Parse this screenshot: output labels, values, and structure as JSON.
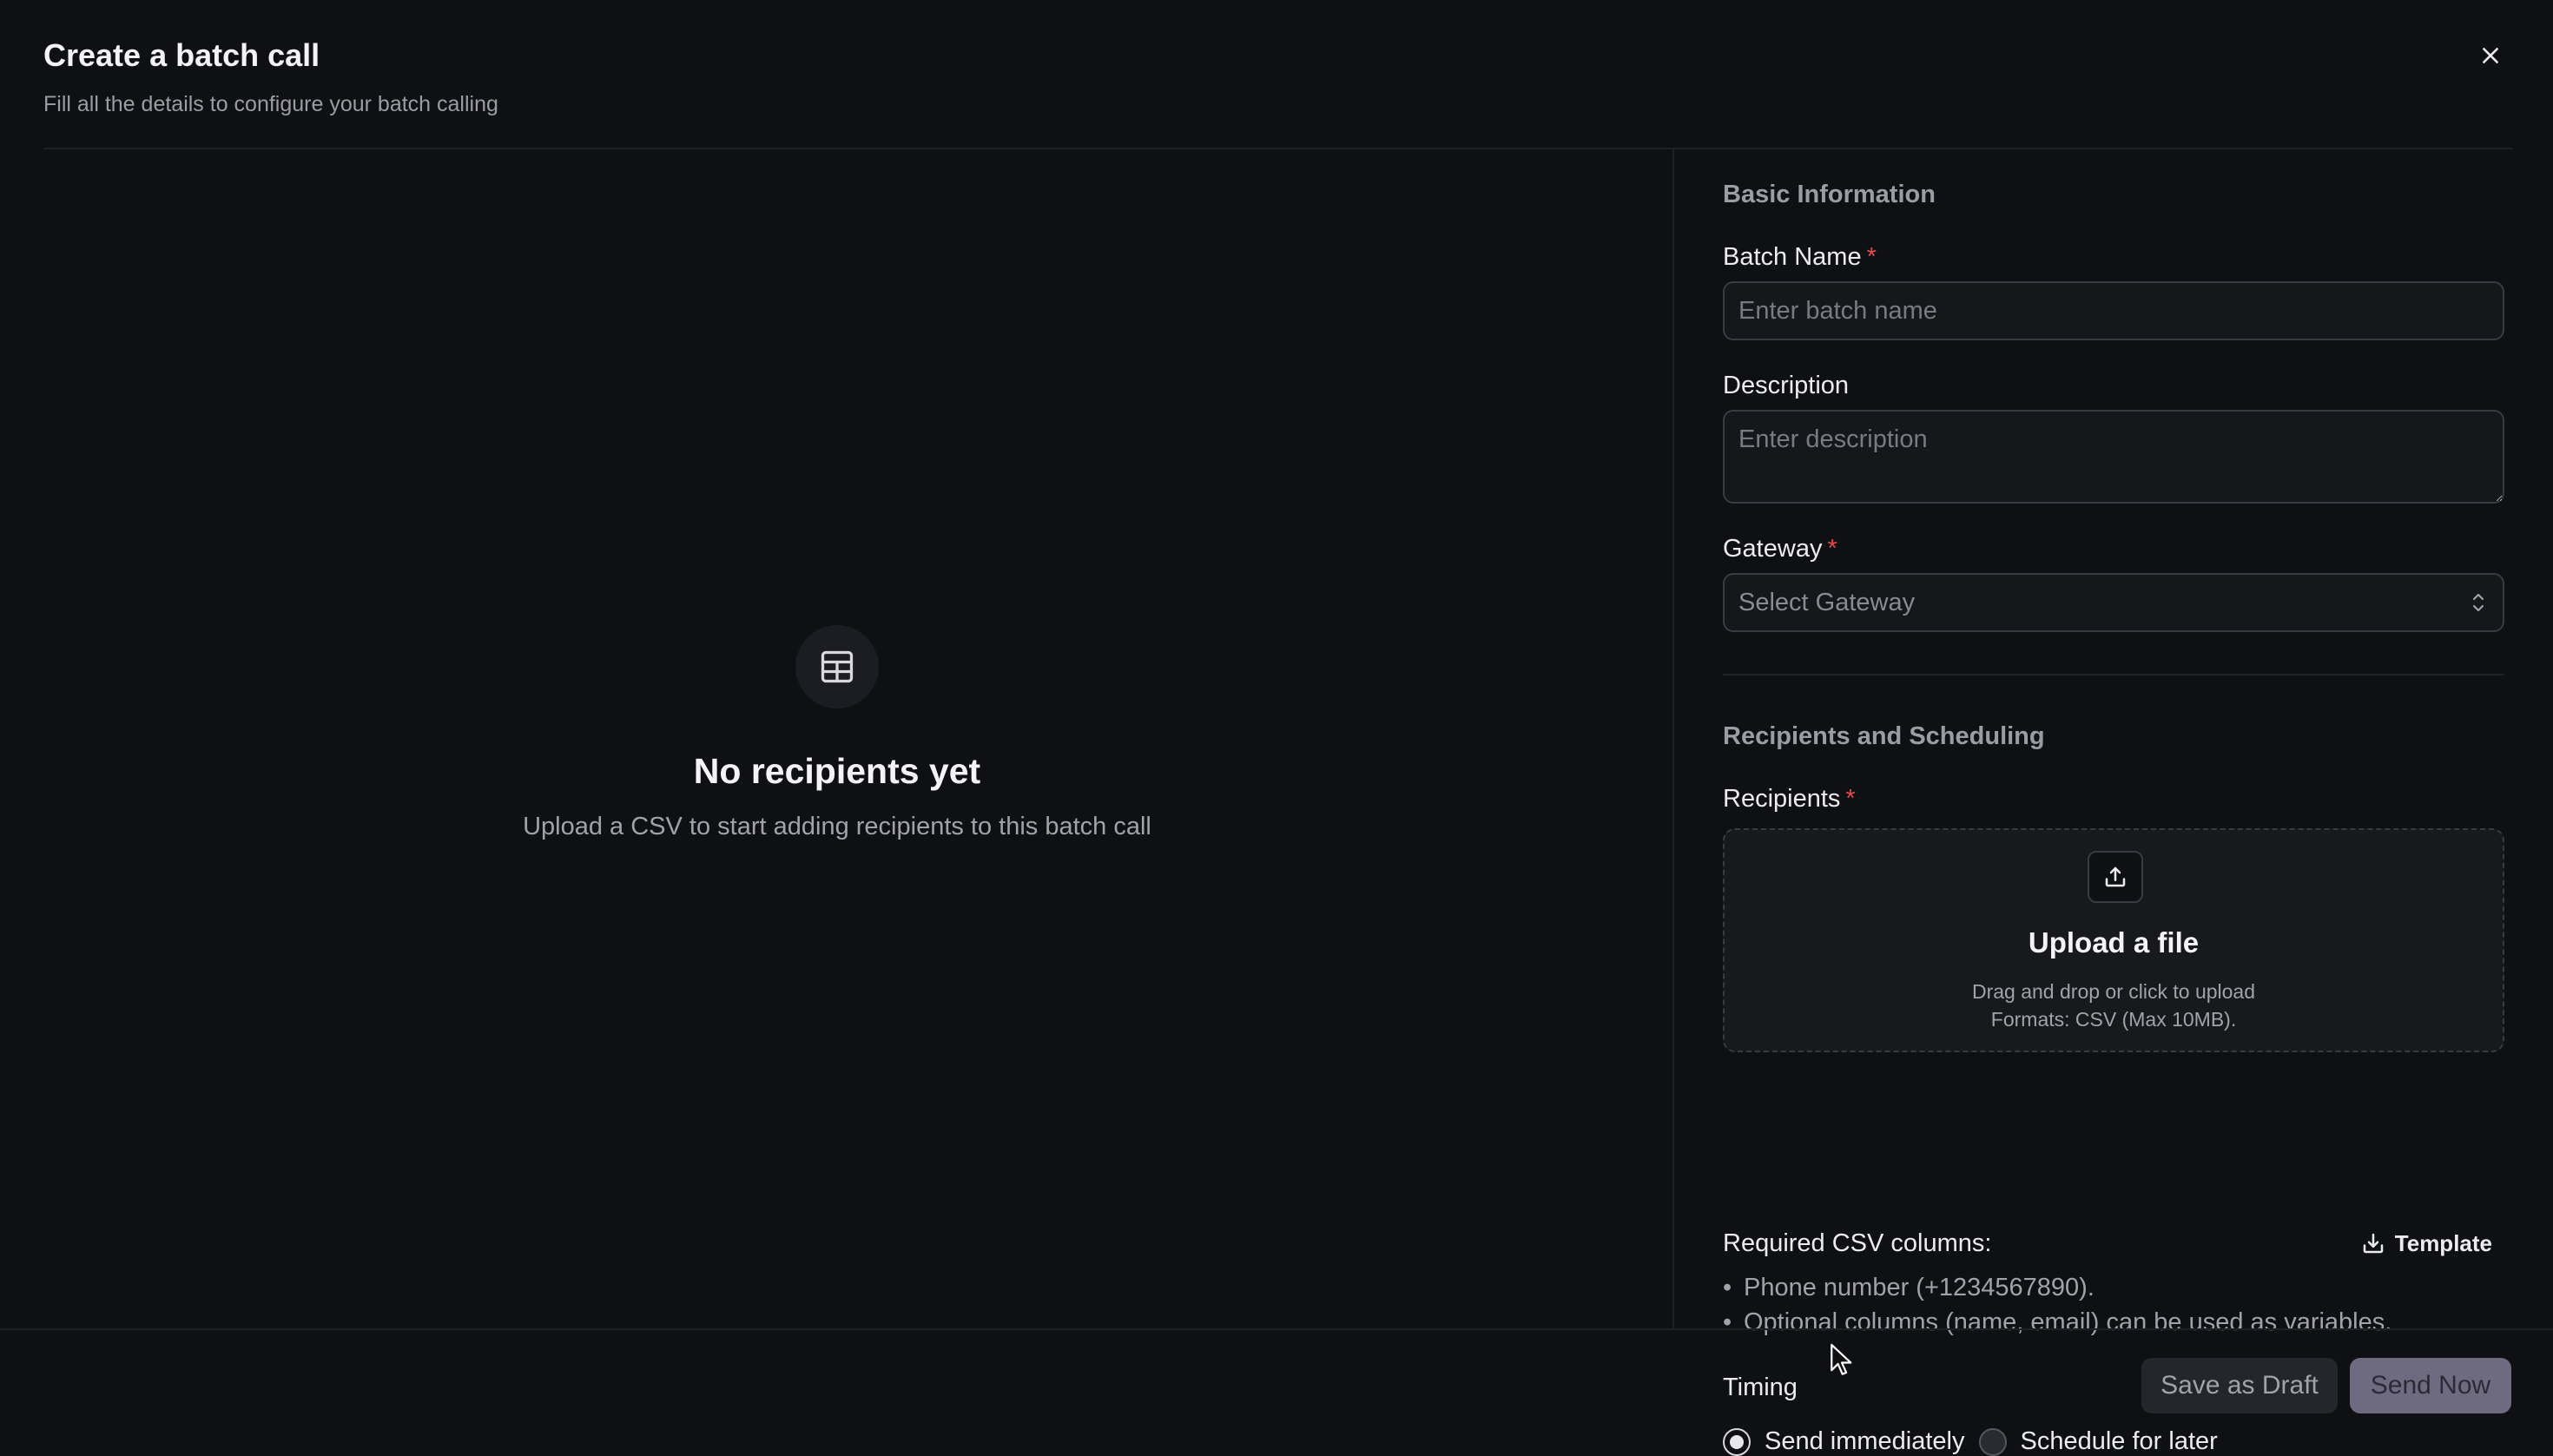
{
  "header": {
    "title": "Create a batch call",
    "subtitle": "Fill all the details to configure your batch calling"
  },
  "empty_state": {
    "icon": "table-icon",
    "title": "No recipients yet",
    "subtitle": "Upload a CSV to start adding recipients to this batch call"
  },
  "basic_info": {
    "section_title": "Basic Information",
    "batch_name": {
      "label": "Batch Name",
      "required_mark": "*",
      "placeholder": "Enter batch name",
      "value": ""
    },
    "description": {
      "label": "Description",
      "placeholder": "Enter description",
      "value": ""
    },
    "gateway": {
      "label": "Gateway",
      "required_mark": "*",
      "placeholder": "Select Gateway"
    }
  },
  "recipients_scheduling": {
    "section_title": "Recipients and Scheduling",
    "recipients": {
      "label": "Recipients",
      "required_mark": "*"
    },
    "upload": {
      "icon": "upload-icon",
      "title": "Upload a file",
      "line1": "Drag and drop or click to upload",
      "line2": "Formats: CSV (Max 10MB)."
    },
    "csv": {
      "label": "Required CSV columns:",
      "template_label": "Template",
      "items": [
        "Phone number (+1234567890).",
        "Optional columns (name, email) can be used as variables."
      ]
    },
    "timing": {
      "label": "Timing",
      "options": [
        {
          "label": "Send immediately",
          "selected": true
        },
        {
          "label": "Schedule for later",
          "selected": false
        }
      ]
    }
  },
  "footer": {
    "save_draft_label": "Save as Draft",
    "send_now_label": "Send Now"
  }
}
